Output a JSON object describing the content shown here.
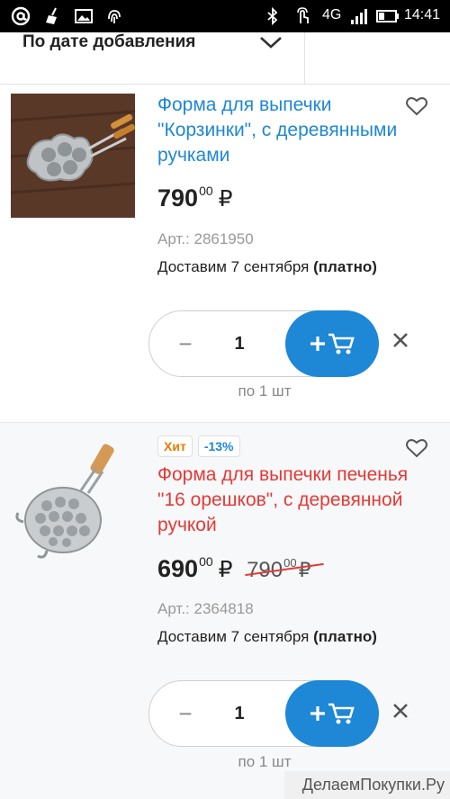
{
  "statusbar": {
    "network": "4G",
    "time": "14:41"
  },
  "sort": {
    "label": "По дате добавления"
  },
  "products": [
    {
      "title": "Форма для выпечки \"Корзинки\", с деревянными ручками",
      "price_main": "790",
      "price_cents": "00",
      "currency": "₽",
      "sku": "Арт.: 2861950",
      "delivery_text": "Доставим 7 сентября",
      "delivery_note": "(платно)",
      "quantity": "1",
      "minus_label": "−",
      "per_unit": "по 1 шт"
    },
    {
      "badge_hit": "Хит",
      "badge_discount": "-13%",
      "title": "Форма для выпечки печенья \"16 орешков\", с деревянной ручкой",
      "price_main": "690",
      "price_cents": "00",
      "currency": "₽",
      "old_price_main": "790",
      "old_price_cents": "00",
      "old_currency": "₽",
      "sku": "Арт.: 2364818",
      "delivery_text": "Доставим 7 сентября",
      "delivery_note": "(платно)",
      "quantity": "1",
      "minus_label": "−",
      "per_unit": "по 1 шт"
    }
  ],
  "watermark": "ДелаемПокупки.Ру",
  "colors": {
    "accent_blue": "#1e87d6",
    "hit_title_red": "#e53935",
    "hit_badge_orange": "#e87a00"
  }
}
